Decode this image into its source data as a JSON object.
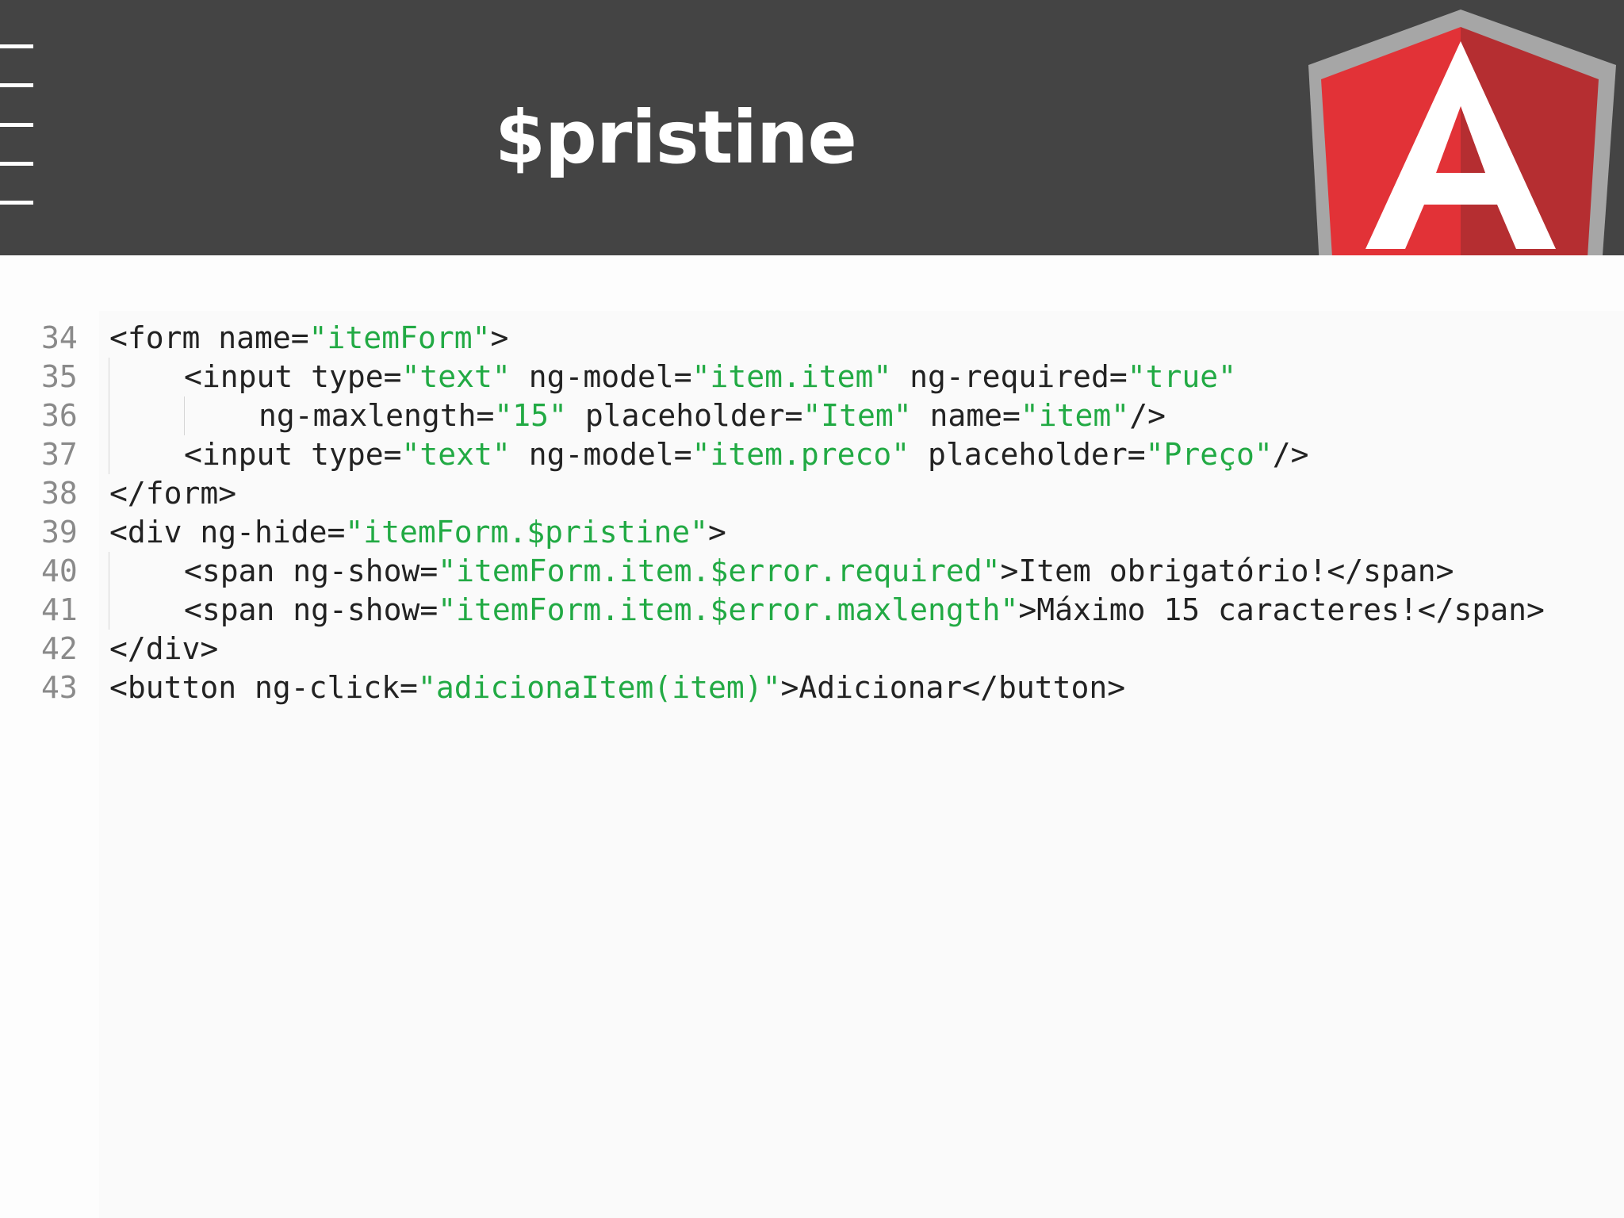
{
  "slide": {
    "title": "$pristine",
    "logo": {
      "icon": "angularjs-logo-icon",
      "letter": "A",
      "colors": {
        "shield_left": "#e23237",
        "shield_right": "#b52e31",
        "border": "#a6a6a6",
        "letter": "#ffffff"
      }
    },
    "menu_icon": "hamburger-menu-icon"
  },
  "colors": {
    "header_background": "#444444",
    "code_text": "#222222",
    "string_literal": "#22aa44",
    "line_number": "#8a8a8a"
  },
  "code": {
    "lines": [
      {
        "number": "34",
        "indent": 0,
        "tokens": [
          {
            "t": "<form name=",
            "k": "txt"
          },
          {
            "t": "\"itemForm\"",
            "k": "str"
          },
          {
            "t": ">",
            "k": "txt"
          }
        ]
      },
      {
        "number": "35",
        "indent": 1,
        "tokens": [
          {
            "t": "<input type=",
            "k": "txt"
          },
          {
            "t": "\"text\"",
            "k": "str"
          },
          {
            "t": " ng-model=",
            "k": "txt"
          },
          {
            "t": "\"item.item\"",
            "k": "str"
          },
          {
            "t": " ng-required=",
            "k": "txt"
          },
          {
            "t": "\"true\"",
            "k": "str"
          }
        ]
      },
      {
        "number": "36",
        "indent": 2,
        "tokens": [
          {
            "t": "ng-maxlength=",
            "k": "txt"
          },
          {
            "t": "\"15\"",
            "k": "str"
          },
          {
            "t": " placeholder=",
            "k": "txt"
          },
          {
            "t": "\"Item\"",
            "k": "str"
          },
          {
            "t": " name=",
            "k": "txt"
          },
          {
            "t": "\"item\"",
            "k": "str"
          },
          {
            "t": "/>",
            "k": "txt"
          }
        ]
      },
      {
        "number": "37",
        "indent": 1,
        "tokens": [
          {
            "t": "<input type=",
            "k": "txt"
          },
          {
            "t": "\"text\"",
            "k": "str"
          },
          {
            "t": " ng-model=",
            "k": "txt"
          },
          {
            "t": "\"item.preco\"",
            "k": "str"
          },
          {
            "t": " placeholder=",
            "k": "txt"
          },
          {
            "t": "\"Preço\"",
            "k": "str"
          },
          {
            "t": "/>",
            "k": "txt"
          }
        ]
      },
      {
        "number": "38",
        "indent": 0,
        "tokens": [
          {
            "t": "</form>",
            "k": "txt"
          }
        ]
      },
      {
        "number": "39",
        "indent": 0,
        "tokens": [
          {
            "t": "<div ng-hide=",
            "k": "txt"
          },
          {
            "t": "\"itemForm.$pristine\"",
            "k": "str"
          },
          {
            "t": ">",
            "k": "txt"
          }
        ]
      },
      {
        "number": "40",
        "indent": 1,
        "tokens": [
          {
            "t": "<span ng-show=",
            "k": "txt"
          },
          {
            "t": "\"itemForm.item.$error.required\"",
            "k": "str"
          },
          {
            "t": ">Item obrigatório!</span>",
            "k": "txt"
          }
        ]
      },
      {
        "number": "41",
        "indent": 1,
        "tokens": [
          {
            "t": "<span ng-show=",
            "k": "txt"
          },
          {
            "t": "\"itemForm.item.$error.maxlength\"",
            "k": "str"
          },
          {
            "t": ">Máximo 15 caracteres!</span>",
            "k": "txt"
          }
        ]
      },
      {
        "number": "42",
        "indent": 0,
        "tokens": [
          {
            "t": "</div>",
            "k": "txt"
          }
        ]
      },
      {
        "number": "43",
        "indent": 0,
        "tokens": [
          {
            "t": "<button ng-click=",
            "k": "txt"
          },
          {
            "t": "\"adicionaItem(item)\"",
            "k": "str"
          },
          {
            "t": ">Adicionar</button>",
            "k": "txt"
          }
        ]
      }
    ]
  }
}
